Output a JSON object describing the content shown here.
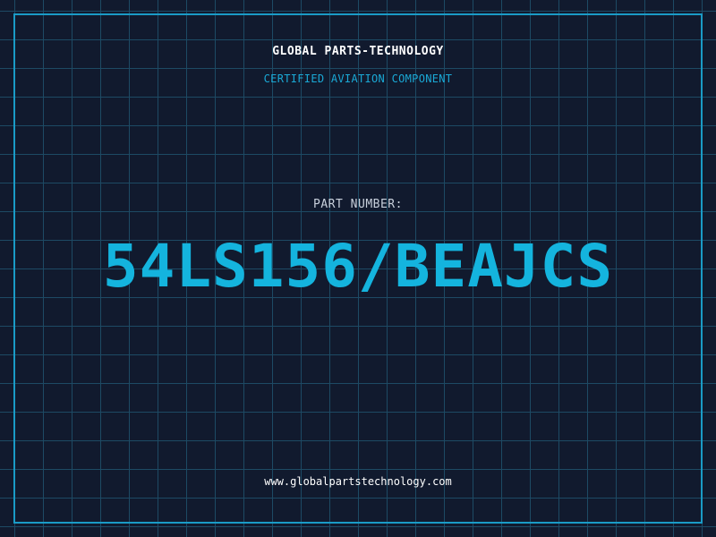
{
  "header": {
    "brand": "GLOBAL PARTS-TECHNOLOGY",
    "subtitle": "CERTIFIED AVIATION COMPONENT"
  },
  "part": {
    "label": "PART NUMBER:",
    "number": "54LS156/BEAJCS"
  },
  "footer": {
    "url": "www.globalpartstechnology.com"
  },
  "colors": {
    "background": "#111a2e",
    "grid": "#1d4a64",
    "frame": "#1a9bc6",
    "accent": "#14b4de"
  }
}
